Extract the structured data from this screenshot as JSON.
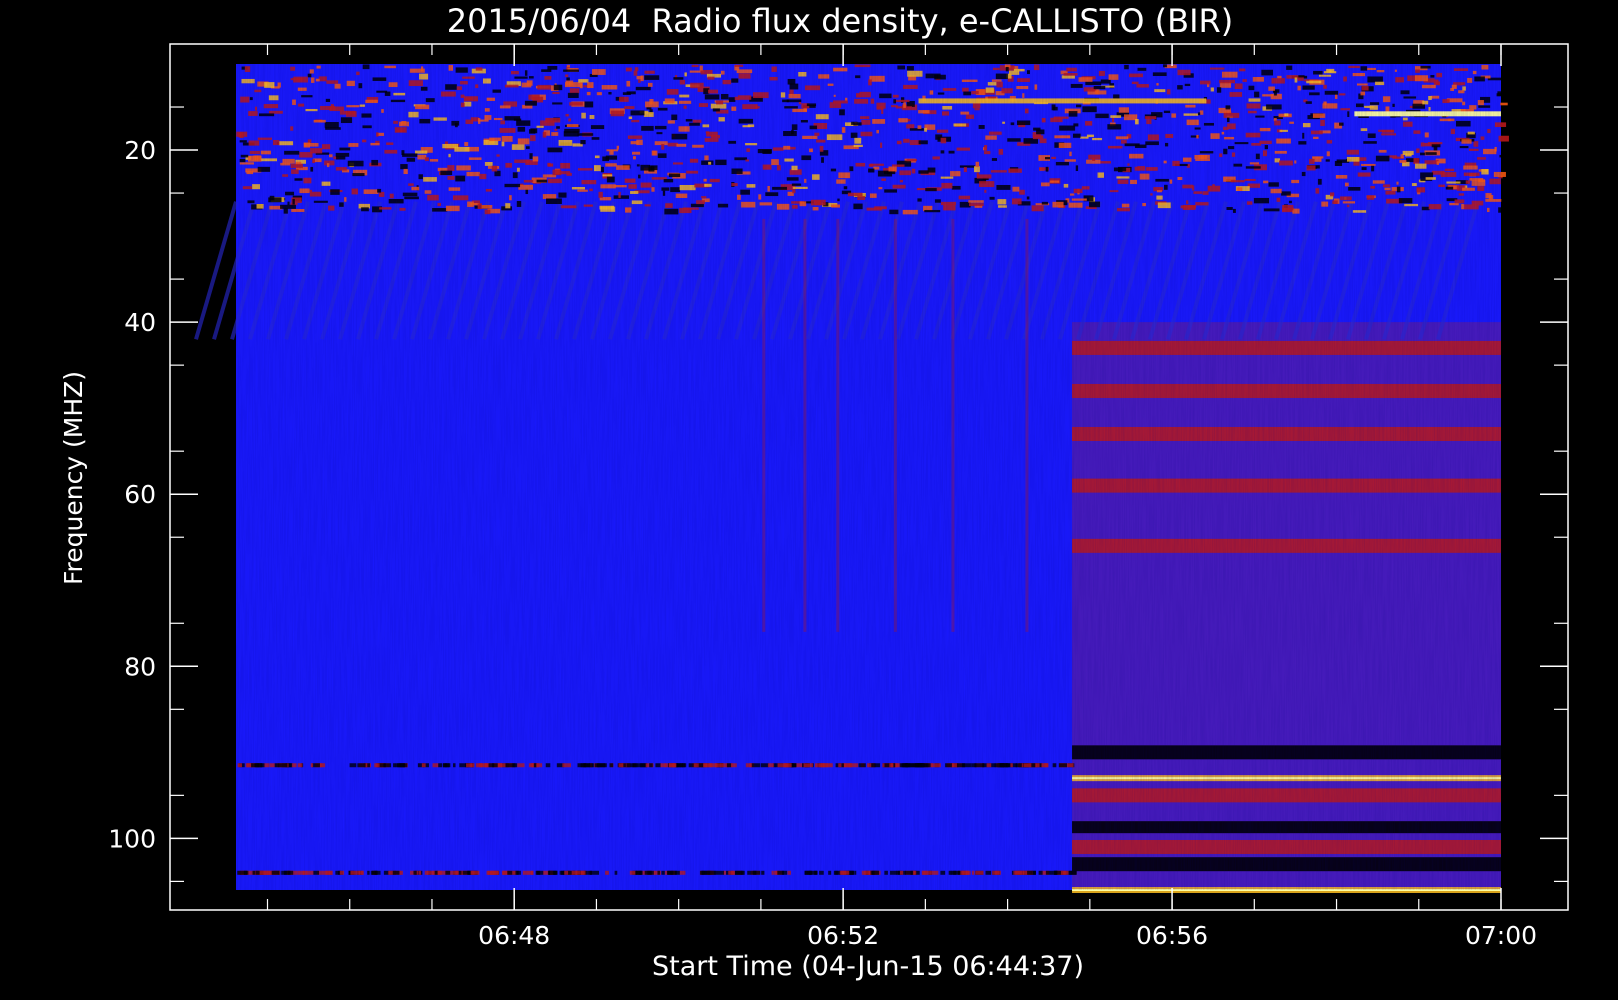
{
  "chart_data": {
    "type": "heatmap",
    "title": "2015/06/04  Radio flux density, e-CALLISTO (BIR)",
    "xlabel": "Start Time (04-Jun-15 06:44:37)",
    "ylabel": "Frequency (MHZ)",
    "x_range": [
      "06:44:37",
      "07:00:00"
    ],
    "y_range_mhz": [
      10,
      106
    ],
    "y_inverted": true,
    "xticks": [
      "06:48",
      "06:52",
      "06:56",
      "07:00"
    ],
    "xtick_minutes": [
      3.383,
      7.383,
      11.383,
      15.383
    ],
    "yticks": [
      "20",
      "40",
      "60",
      "80",
      "100"
    ],
    "ytick_values": [
      20,
      40,
      60,
      80,
      100
    ],
    "grid": false,
    "colors": {
      "background": "#000000",
      "low": "#1a1aff",
      "medium": "#c01a1a",
      "high": "#ffc020",
      "peak": "#ffffa0"
    },
    "observed_features": {
      "receiver_change_time": "06:54:47",
      "rfi_bands_mhz_after_change": [
        43,
        48,
        53,
        59,
        66,
        90,
        93,
        95,
        101,
        103,
        106
      ],
      "noisy_band_mhz": [
        10,
        27
      ]
    }
  }
}
